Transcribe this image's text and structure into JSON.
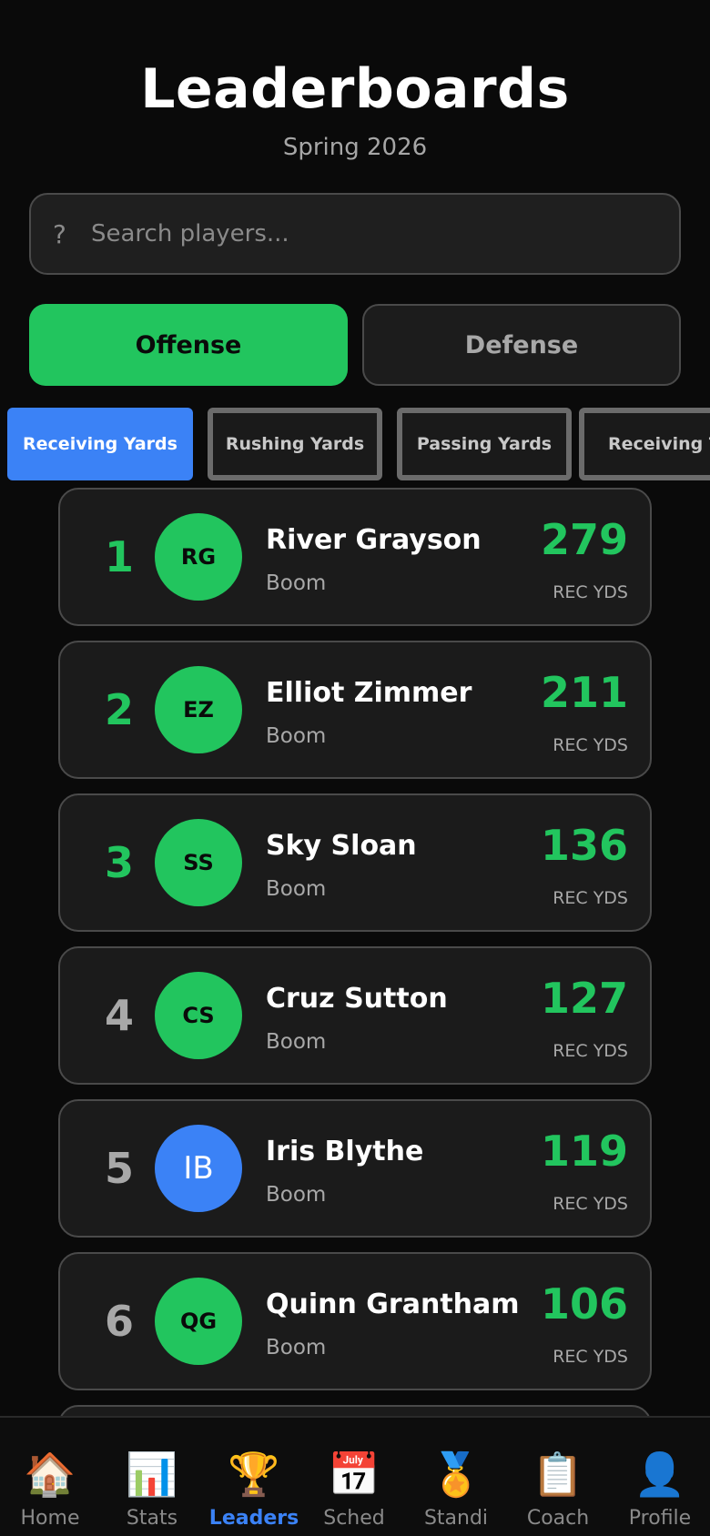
{
  "header": {
    "title": "Leaderboards",
    "subtitle": "Spring 2026"
  },
  "search": {
    "icon": "?",
    "placeholder": "Search players..."
  },
  "segments": {
    "offense": "Offense",
    "defense": "Defense",
    "active": "offense"
  },
  "categories": [
    "Receiving Yards",
    "Rushing Yards",
    "Passing Yards",
    "Receiving T"
  ],
  "players": [
    {
      "rank": "1",
      "initials": "RG",
      "name": "River Grayson",
      "team": "Boom",
      "value": "279",
      "unit": "REC YDS"
    },
    {
      "rank": "2",
      "initials": "EZ",
      "name": "Elliot Zimmer",
      "team": "Boom",
      "value": "211",
      "unit": "REC YDS"
    },
    {
      "rank": "3",
      "initials": "SS",
      "name": "Sky Sloan",
      "team": "Boom",
      "value": "136",
      "unit": "REC YDS"
    },
    {
      "rank": "4",
      "initials": "CS",
      "name": "Cruz Sutton",
      "team": "Boom",
      "value": "127",
      "unit": "REC YDS"
    },
    {
      "rank": "5",
      "initials": "IB",
      "name": "Iris Blythe",
      "team": "Boom",
      "value": "119",
      "unit": "REC YDS"
    },
    {
      "rank": "6",
      "initials": "QG",
      "name": "Quinn Grantham",
      "team": "Boom",
      "value": "106",
      "unit": "REC YDS"
    }
  ],
  "nav": [
    {
      "icon": "🏠",
      "icon_name": "home-icon",
      "label": "Home"
    },
    {
      "icon": "📊",
      "icon_name": "stats-icon",
      "label": "Stats"
    },
    {
      "icon": "🏆",
      "icon_name": "trophy-icon",
      "label": "Leaders"
    },
    {
      "icon": "📅",
      "icon_name": "calendar-icon",
      "label": "Sched"
    },
    {
      "icon": "🏅",
      "icon_name": "medal-icon",
      "label": "Standi"
    },
    {
      "icon": "📋",
      "icon_name": "clipboard-icon",
      "label": "Coach"
    },
    {
      "icon": "👤",
      "icon_name": "profile-icon",
      "label": "Profile"
    }
  ],
  "colors": {
    "accent": "#22c55e",
    "active_tab": "#3b82f6",
    "background": "#0a0a0a"
  }
}
